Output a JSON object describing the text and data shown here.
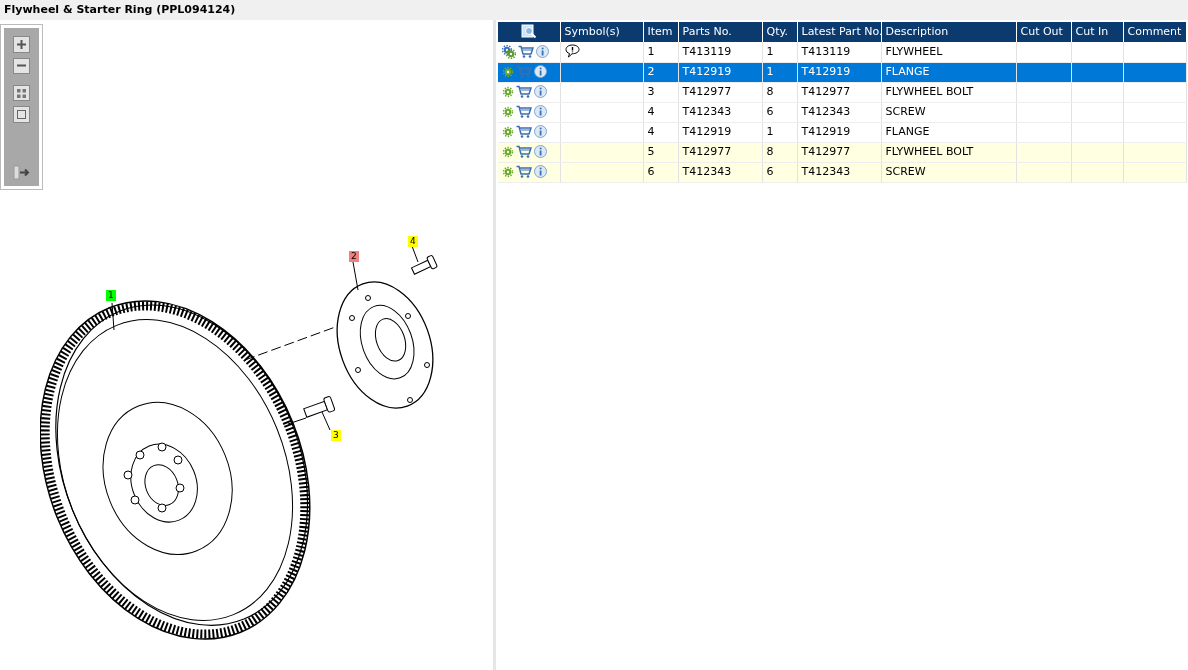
{
  "title": "Flywheel & Starter Ring (PPL094124)",
  "callouts": [
    {
      "label": "1",
      "color": "#00ff00"
    },
    {
      "label": "2",
      "color": "#f08080"
    },
    {
      "label": "3",
      "color": "#ffff00"
    },
    {
      "label": "4",
      "color": "#ffff00"
    }
  ],
  "table": {
    "columns": [
      "Symbol(s)",
      "Item",
      "Parts No.",
      "Qty.",
      "Latest Part No.",
      "Description",
      "Cut Out",
      "Cut In",
      "Comment"
    ],
    "rows": [
      {
        "kind": "assembly",
        "selected": false,
        "highlighted": false,
        "note_symbol": true,
        "cells": [
          "",
          "1",
          "T413119",
          "1",
          "T413119",
          "FLYWHEEL"
        ]
      },
      {
        "kind": "part",
        "selected": true,
        "note_symbol": false,
        "cells": [
          "",
          "2",
          "T412919",
          "1",
          "T412919",
          "FLANGE"
        ]
      },
      {
        "kind": "part",
        "selected": false,
        "highlighted": false,
        "note_symbol": false,
        "cells": [
          "",
          "3",
          "T412977",
          "8",
          "T412977",
          "FLYWHEEL BOLT"
        ]
      },
      {
        "kind": "part",
        "selected": false,
        "highlighted": false,
        "note_symbol": false,
        "cells": [
          "",
          "4",
          "T412343",
          "6",
          "T412343",
          "SCREW"
        ]
      },
      {
        "kind": "part",
        "selected": false,
        "highlighted": false,
        "note_symbol": false,
        "cells": [
          "",
          "4",
          "T412919",
          "1",
          "T412919",
          "FLANGE"
        ]
      },
      {
        "kind": "part",
        "selected": false,
        "highlighted": true,
        "note_symbol": false,
        "cells": [
          "",
          "5",
          "T412977",
          "8",
          "T412977",
          "FLYWHEEL BOLT"
        ]
      },
      {
        "kind": "part",
        "selected": false,
        "highlighted": true,
        "note_symbol": false,
        "cells": [
          "",
          "6",
          "T412343",
          "6",
          "T412343",
          "SCREW"
        ]
      }
    ]
  }
}
